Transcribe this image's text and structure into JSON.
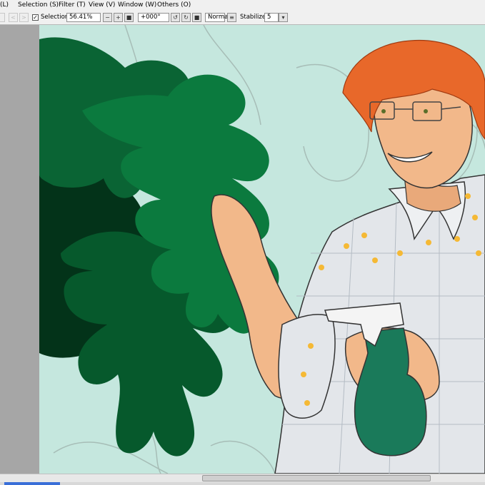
{
  "menu": [
    {
      "id": "layer",
      "label": "(L)"
    },
    {
      "id": "selection",
      "label": "Selection (S)"
    },
    {
      "id": "filter",
      "label": "Filter (T)"
    },
    {
      "id": "view",
      "label": "View (V)"
    },
    {
      "id": "window",
      "label": "Window (W)"
    },
    {
      "id": "others",
      "label": "Others (O)"
    }
  ],
  "toolbar": {
    "selection_checkbox": {
      "label": "Selection",
      "checked": true
    },
    "zoom": "56.41%",
    "rotation": "+000°",
    "blend_mode": "Normal",
    "stabilizer_label": "Stabilizer",
    "stabilizer_value": "5"
  },
  "canvas": {
    "background": "#c5e7de",
    "artwork": "illustration-man-with-spray-bottle-and-monstera"
  },
  "colors": {
    "leaf_light": "#0b7a3e",
    "leaf_mid": "#06592c",
    "leaf_dark": "#033319",
    "hair": "#e8682a",
    "skin": "#f2b88a",
    "shirt": "#e3e6ea",
    "bottle": "#1a7a5a"
  }
}
